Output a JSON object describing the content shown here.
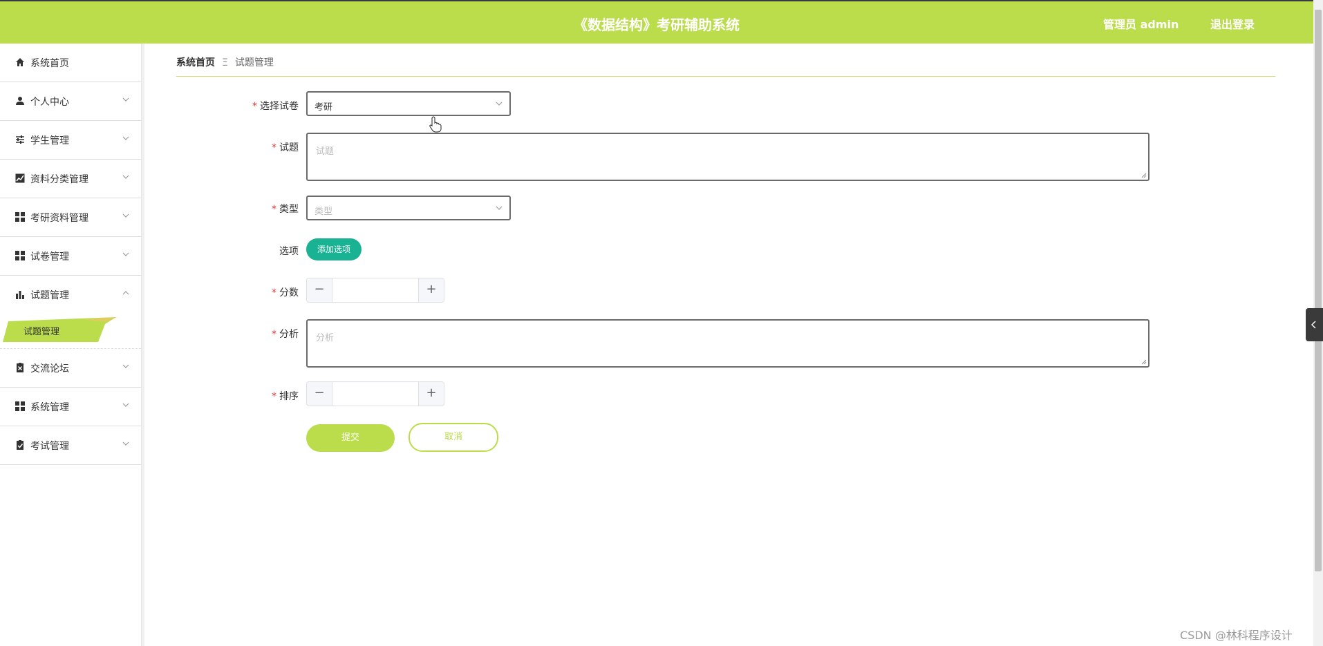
{
  "header": {
    "title": "《数据结构》考研辅助系统",
    "user_label": "管理员 admin",
    "logout_label": "退出登录",
    "accent_color": "#bbdd4c"
  },
  "sidebar": {
    "items": [
      {
        "label": "系统首页",
        "icon": "home-icon"
      },
      {
        "label": "个人中心",
        "icon": "user-icon"
      },
      {
        "label": "学生管理",
        "icon": "sliders-icon"
      },
      {
        "label": "资料分类管理",
        "icon": "trend-chart-icon"
      },
      {
        "label": "考研资料管理",
        "icon": "grid-icon"
      },
      {
        "label": "试卷管理",
        "icon": "grid-icon"
      },
      {
        "label": "试题管理",
        "icon": "bar-chart-icon",
        "expanded": true
      },
      {
        "label": "交流论坛",
        "icon": "clipboard-x-icon"
      },
      {
        "label": "系统管理",
        "icon": "grid-icon"
      },
      {
        "label": "考试管理",
        "icon": "clipboard-check-icon"
      }
    ],
    "active_sub_item": "试题管理"
  },
  "breadcrumb": {
    "home": "系统首页",
    "separator": "Ξ",
    "current": "试题管理"
  },
  "form": {
    "paper": {
      "label": "选择试卷",
      "value": "考研"
    },
    "question": {
      "label": "试题",
      "placeholder": "试题"
    },
    "type": {
      "label": "类型",
      "placeholder": "类型"
    },
    "options": {
      "label": "选项",
      "add_button": "添加选项"
    },
    "score": {
      "label": "分数",
      "minus": "−",
      "plus": "+"
    },
    "analysis": {
      "label": "分析",
      "placeholder": "分析"
    },
    "sort": {
      "label": "排序",
      "minus": "−",
      "plus": "+"
    },
    "required_mark": "*",
    "submit_label": "提交",
    "cancel_label": "取消"
  },
  "watermark": "CSDN @林科程序设计"
}
